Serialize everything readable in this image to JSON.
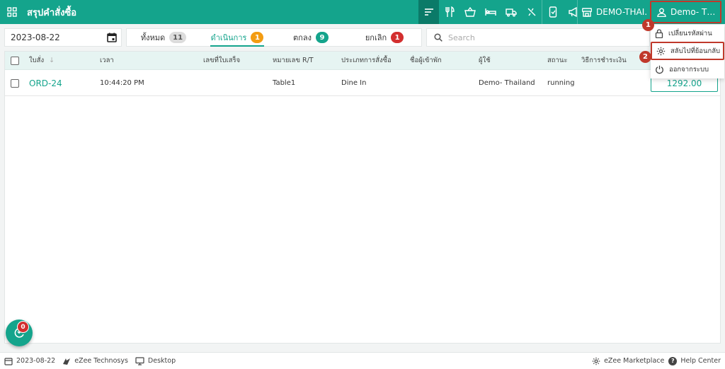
{
  "header": {
    "title": "สรุปคำสั่งซื้อ",
    "store_label": "DEMO-THAI...",
    "user_label": "Demo- Thail...",
    "icons": [
      "sort-icon",
      "restaurant-icon",
      "basket-icon",
      "bed-icon",
      "truck-icon",
      "no-charge-icon",
      "phone-order-icon",
      "megaphone-icon"
    ]
  },
  "filters": {
    "date": "2023-08-22",
    "tabs": [
      {
        "label": "ทั้งหมด",
        "count": "11",
        "color": "#dcdcdc",
        "text_color": "#555555"
      },
      {
        "label": "ดำเนินการ",
        "count": "1",
        "color": "#f39c12",
        "text_color": "#ffffff"
      },
      {
        "label": "ตกลง",
        "count": "9",
        "color": "#14a48c",
        "text_color": "#ffffff"
      },
      {
        "label": "ยกเลิก",
        "count": "1",
        "color": "#d32f2f",
        "text_color": "#ffffff"
      }
    ],
    "active_tab": 1,
    "search_placeholder": "Search"
  },
  "table": {
    "columns": [
      "ใบสั่ง",
      "เวลา",
      "เลขที่ใบเสร็จ",
      "หมายเลข R/T",
      "ประเภทการสั่งซื้อ",
      "ชื่อผู้เข้าพัก",
      "ผู้ใช้",
      "สถานะ",
      "วิธีการชำระเงิน"
    ],
    "rows": [
      {
        "order": "ORD-24",
        "time": "10:44:20 PM",
        "receipt": "",
        "rt": "Table1",
        "type": "Dine In",
        "guest": "",
        "user": "Demo- Thailand",
        "status": "running",
        "payment": "",
        "amount": "1292.00"
      }
    ]
  },
  "user_menu": {
    "items": [
      {
        "label": "เปลี่ยนรหัสผ่าน",
        "icon": "lock-icon"
      },
      {
        "label": "สลับไปที่ย้อนกลับ",
        "icon": "gear-icon"
      },
      {
        "label": "ออกจากระบบ",
        "icon": "power-icon"
      }
    ],
    "callouts": [
      "1",
      "2"
    ]
  },
  "fab": {
    "badge": "0"
  },
  "footer": {
    "date": "2023-08-22",
    "company": "eZee Technosys",
    "device": "Desktop",
    "marketplace": "eZee Marketplace",
    "help": "Help Center"
  },
  "colors": {
    "primary": "#14a48c",
    "primary_dark": "#0b7a68",
    "highlight": "#c0392b"
  }
}
